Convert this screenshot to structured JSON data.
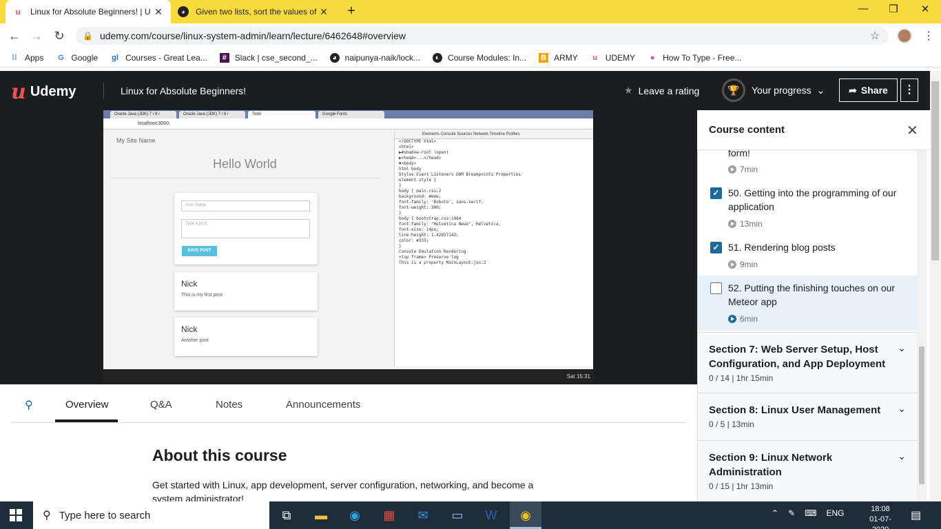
{
  "browser": {
    "tabs": [
      {
        "title": "Linux for Absolute Beginners! | U",
        "favicon": "udemy-icon"
      },
      {
        "title": "Given two lists, sort the values of",
        "favicon": "github-icon"
      }
    ],
    "url": "udemy.com/course/linux-system-admin/learn/lecture/6462648#overview",
    "bookmarks": [
      {
        "label": "Apps",
        "icon": "apps-grid-icon"
      },
      {
        "label": "Google",
        "icon": "google-icon"
      },
      {
        "label": "Courses - Great Lea...",
        "icon": "greatlearning-icon"
      },
      {
        "label": "Slack | cse_second_...",
        "icon": "slack-icon"
      },
      {
        "label": "naipunya-naik/lock...",
        "icon": "github-icon"
      },
      {
        "label": "Course Modules: In...",
        "icon": "course-icon"
      },
      {
        "label": "ARMY",
        "icon": "bookmark-icon"
      },
      {
        "label": "UDEMY",
        "icon": "udemy-icon"
      },
      {
        "label": "How To Type - Free...",
        "icon": "typing-icon"
      }
    ]
  },
  "header": {
    "logo": "Udemy",
    "course_title": "Linux for Absolute Beginners!",
    "rating_label": "Leave a rating",
    "progress_label": "Your progress",
    "share_label": "Share"
  },
  "video": {
    "tabs": [
      "Oracle Java (JDK) 7 / 8 /",
      "Oracle Java (JDK) 7 / 8 /",
      "Todo",
      "Google Fonts"
    ],
    "address": "localhost:3000",
    "site_name": "My Site Name",
    "hello": "Hello World",
    "username_placeholder": "User Name",
    "post_placeholder": "Type a post",
    "save_label": "SAVE POST",
    "posts": [
      {
        "name": "Nick",
        "text": "This is my first post"
      },
      {
        "name": "Nick",
        "text": "Antoher post"
      }
    ],
    "devtools_tabs": "Elements  Console  Sources  Network  Timeline  Profiles",
    "devtools_lines": [
      "<!DOCTYPE html>",
      "<html>",
      "▶#shadow-root (open)",
      "▶<head>...</head>",
      "▼<body>",
      "",
      "html  body",
      "Styles  Event Listeners  DOM Breakpoints  Properties",
      "element.style {",
      "}",
      "body {                main.css:2",
      "  background: #eee;",
      "  font-family: 'Roboto', sans-serif;",
      "  font-weight: 300;",
      "}",
      "body {          bootstrap.css:1084",
      "  font-family: \"Helvetica Neue\", Helvetica,",
      "  font-size: 14px;",
      "  line-height: 1.42857143;",
      "  color: #333;",
      "}",
      "Console  Emulation  Rendering",
      "<top frame>   Preserve log",
      "This is a property      MainLayout.jsx:2"
    ],
    "clock": "Sat 15:31"
  },
  "course_tabs": [
    "Overview",
    "Q&A",
    "Notes",
    "Announcements"
  ],
  "about": {
    "title": "About this course",
    "description": "Get started with Linux, app development, server configuration, networking, and become a system administrator!"
  },
  "sidebar": {
    "title": "Course content",
    "partial": {
      "title": "form!",
      "duration": "7min"
    },
    "lectures": [
      {
        "title": "50. Getting into the programming of our application",
        "duration": "13min",
        "checked": true
      },
      {
        "title": "51. Rendering blog posts",
        "duration": "9min",
        "checked": true
      },
      {
        "title": "52. Putting the finishing touches on our Meteor app",
        "duration": "6min",
        "checked": false
      }
    ],
    "sections": [
      {
        "title": "Section 7: Web Server Setup, Host Configuration, and App Deployment",
        "meta": "0 / 14 | 1hr 15min"
      },
      {
        "title": "Section 8: Linux User Management",
        "meta": "0 / 5 | 13min"
      },
      {
        "title": "Section 9: Linux Network Administration",
        "meta": "0 / 15 | 1hr 13min"
      }
    ]
  },
  "taskbar": {
    "search_placeholder": "Type here to search",
    "lang": "ENG",
    "time": "18:08",
    "date": "01-07-2020"
  }
}
